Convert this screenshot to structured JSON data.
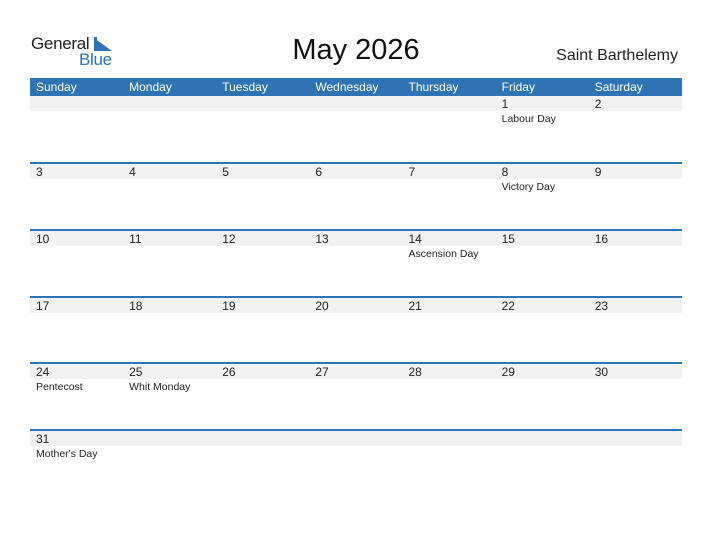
{
  "logo": {
    "line1": "General",
    "line2": "Blue"
  },
  "title": "May 2026",
  "country": "Saint Barthelemy",
  "colors": {
    "accent": "#2e74b5",
    "band": "#f2f2f2"
  },
  "weekdays": [
    "Sunday",
    "Monday",
    "Tuesday",
    "Wednesday",
    "Thursday",
    "Friday",
    "Saturday"
  ],
  "weeks": [
    [
      {
        "day": "",
        "holiday": ""
      },
      {
        "day": "",
        "holiday": ""
      },
      {
        "day": "",
        "holiday": ""
      },
      {
        "day": "",
        "holiday": ""
      },
      {
        "day": "",
        "holiday": ""
      },
      {
        "day": "1",
        "holiday": "Labour Day"
      },
      {
        "day": "2",
        "holiday": ""
      }
    ],
    [
      {
        "day": "3",
        "holiday": ""
      },
      {
        "day": "4",
        "holiday": ""
      },
      {
        "day": "5",
        "holiday": ""
      },
      {
        "day": "6",
        "holiday": ""
      },
      {
        "day": "7",
        "holiday": ""
      },
      {
        "day": "8",
        "holiday": "Victory Day"
      },
      {
        "day": "9",
        "holiday": ""
      }
    ],
    [
      {
        "day": "10",
        "holiday": ""
      },
      {
        "day": "11",
        "holiday": ""
      },
      {
        "day": "12",
        "holiday": ""
      },
      {
        "day": "13",
        "holiday": ""
      },
      {
        "day": "14",
        "holiday": "Ascension Day"
      },
      {
        "day": "15",
        "holiday": ""
      },
      {
        "day": "16",
        "holiday": ""
      }
    ],
    [
      {
        "day": "17",
        "holiday": ""
      },
      {
        "day": "18",
        "holiday": ""
      },
      {
        "day": "19",
        "holiday": ""
      },
      {
        "day": "20",
        "holiday": ""
      },
      {
        "day": "21",
        "holiday": ""
      },
      {
        "day": "22",
        "holiday": ""
      },
      {
        "day": "23",
        "holiday": ""
      }
    ],
    [
      {
        "day": "24",
        "holiday": "Pentecost"
      },
      {
        "day": "25",
        "holiday": "Whit Monday"
      },
      {
        "day": "26",
        "holiday": ""
      },
      {
        "day": "27",
        "holiday": ""
      },
      {
        "day": "28",
        "holiday": ""
      },
      {
        "day": "29",
        "holiday": ""
      },
      {
        "day": "30",
        "holiday": ""
      }
    ],
    [
      {
        "day": "31",
        "holiday": "Mother's Day"
      },
      {
        "day": "",
        "holiday": ""
      },
      {
        "day": "",
        "holiday": ""
      },
      {
        "day": "",
        "holiday": ""
      },
      {
        "day": "",
        "holiday": ""
      },
      {
        "day": "",
        "holiday": ""
      },
      {
        "day": "",
        "holiday": ""
      }
    ]
  ]
}
